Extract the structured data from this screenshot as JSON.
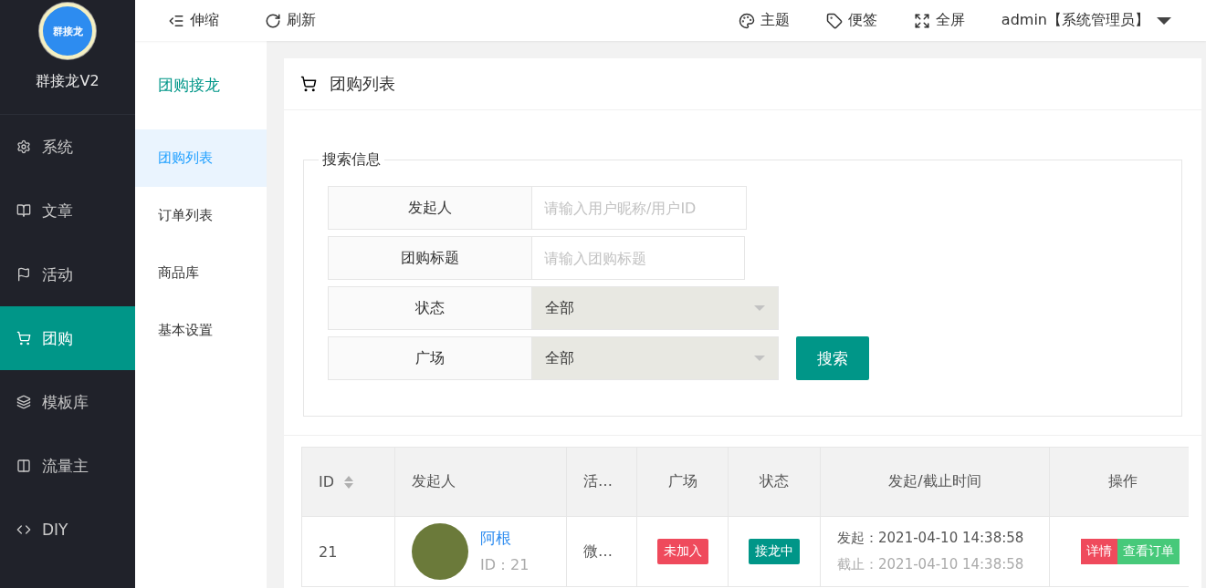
{
  "sidebar": {
    "logo_text": "群接龙",
    "app_name": "群接龙V2",
    "items": [
      {
        "label": "系统",
        "kind": "gear",
        "selected": false
      },
      {
        "label": "文章",
        "kind": "book",
        "selected": false
      },
      {
        "label": "活动",
        "kind": "flag",
        "selected": false
      },
      {
        "label": "团购",
        "kind": "cart",
        "selected": true
      },
      {
        "label": "模板库",
        "kind": "layers",
        "selected": false
      },
      {
        "label": "流量主",
        "kind": "columns",
        "selected": false
      },
      {
        "label": "DIY",
        "kind": "code",
        "selected": false
      }
    ]
  },
  "toolbar": {
    "left": [
      {
        "label": "伸缩",
        "kind": "indent"
      },
      {
        "label": "刷新",
        "kind": "refresh"
      }
    ],
    "right": [
      {
        "label": "主题",
        "kind": "palette"
      },
      {
        "label": "便签",
        "kind": "tag"
      },
      {
        "label": "全屏",
        "kind": "expand"
      }
    ],
    "user": "admin【系统管理员】"
  },
  "subnav": {
    "title": "团购接龙",
    "items": [
      {
        "label": "团购列表",
        "selected": true
      },
      {
        "label": "订单列表",
        "selected": false
      },
      {
        "label": "商品库",
        "selected": false
      },
      {
        "label": "基本设置",
        "selected": false
      }
    ]
  },
  "page_title": "团购列表",
  "search": {
    "legend": "搜索信息",
    "fields": [
      {
        "kind": "input",
        "label": "发起人",
        "placeholder": "请输入用户昵称/用户ID"
      },
      {
        "kind": "input",
        "label": "团购标题",
        "placeholder": "请输入团购标题"
      },
      {
        "kind": "select",
        "label": "状态",
        "value": "全部"
      },
      {
        "kind": "select",
        "label": "广场",
        "value": "全部"
      }
    ],
    "button": "搜索"
  },
  "table": {
    "columns": [
      "ID",
      "发起人",
      "活…",
      "广场",
      "状态",
      "发起/截止时间",
      "操作"
    ],
    "rows": [
      {
        "id": "21",
        "name": "阿根",
        "user_id": "ID：21",
        "activity": "微…",
        "plaza": "未加入",
        "status": "接龙中",
        "start": "发起：2021-04-10 14:38:58",
        "end": "截止：2021-04-10 14:38:58",
        "actions": [
          "详情",
          "查看订单"
        ]
      }
    ]
  }
}
